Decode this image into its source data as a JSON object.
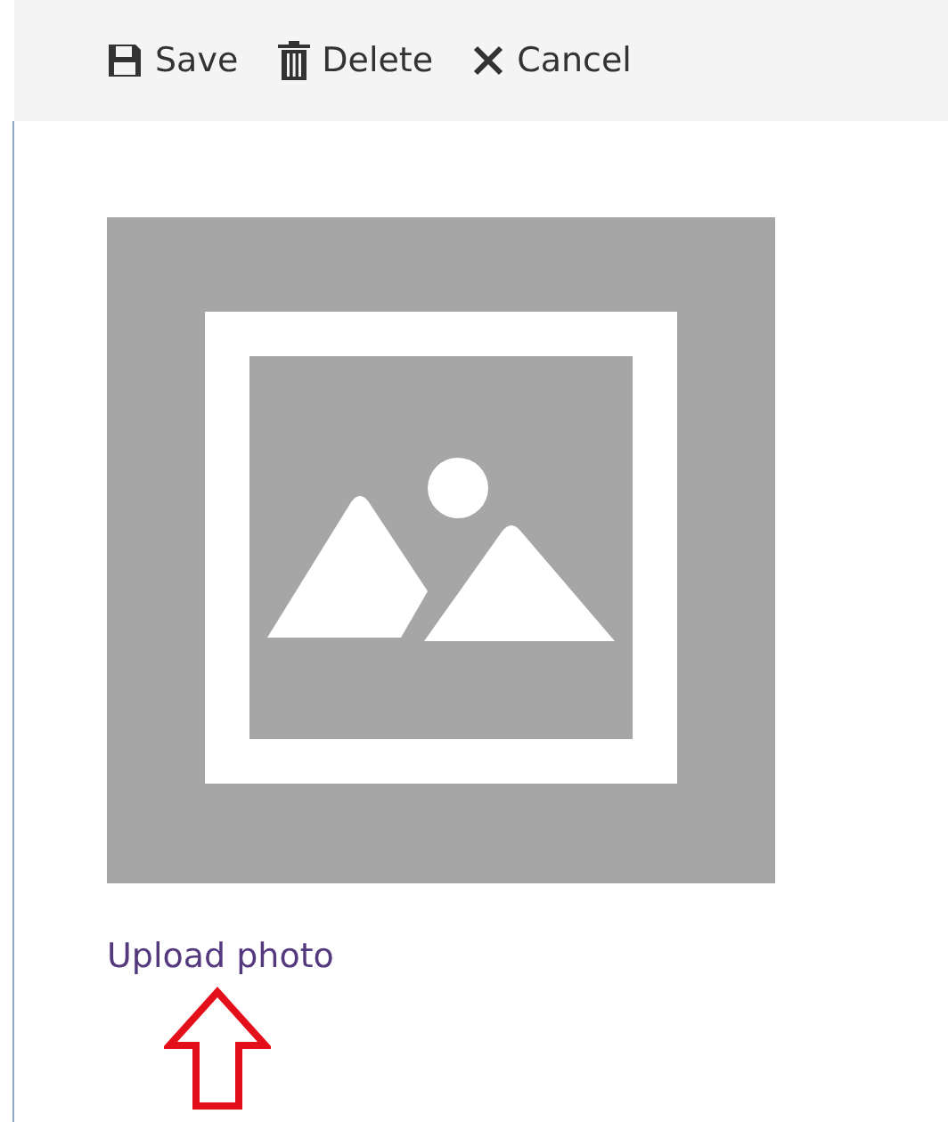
{
  "toolbar": {
    "buttons": [
      {
        "kind": "save",
        "label": "Save"
      },
      {
        "kind": "delete",
        "label": "Delete"
      },
      {
        "kind": "cancel",
        "label": "Cancel"
      }
    ]
  },
  "photo": {
    "upload_link": "Upload photo"
  }
}
